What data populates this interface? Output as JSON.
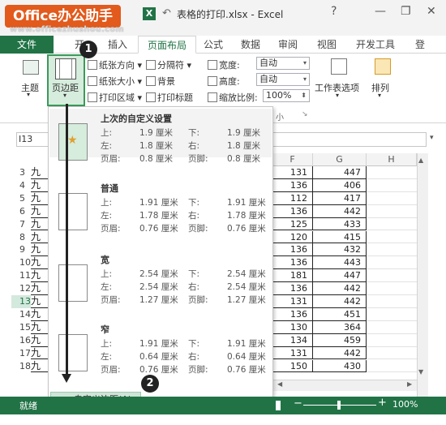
{
  "brand": {
    "name": "Office办公助手",
    "site": "www.officezhushou.com"
  },
  "window": {
    "title": "表格的打印.xlsx - Excel",
    "help": "?",
    "minimize": "—",
    "restore": "❐",
    "close": "✕"
  },
  "tabs": {
    "file": "文件",
    "start": "开",
    "insert": "插入",
    "page_layout": "页面布局",
    "formulas": "公式",
    "data": "数据",
    "review": "审阅",
    "view": "视图",
    "developer": "开发工具",
    "login": "登"
  },
  "ribbon": {
    "themes": "主题",
    "margins": "页边距",
    "orientation": "纸张方向 ▾",
    "size": "纸张大小 ▾",
    "print_area": "打印区域 ▾",
    "breaks": "分隔符 ▾",
    "background": "背景",
    "print_titles": "打印标题",
    "width_label": "宽度:",
    "width_value": "自动",
    "height_label": "高度:",
    "height_value": "自动",
    "scale_label": "缩放比例:",
    "scale_value": "100%",
    "sheet_options": "工作表选项",
    "arrange": "排列",
    "group_label_small": "小"
  },
  "margin_menu": {
    "presets": [
      {
        "title": "上次的自定义设置",
        "rows": [
          [
            "上:",
            "1.9 厘米",
            "下:",
            "1.9 厘米"
          ],
          [
            "左:",
            "1.8 厘米",
            "右:",
            "1.8 厘米"
          ],
          [
            "页眉:",
            "0.8 厘米",
            "页脚:",
            "0.8 厘米"
          ]
        ]
      },
      {
        "title": "普通",
        "rows": [
          [
            "上:",
            "1.91 厘米",
            "下:",
            "1.91 厘米"
          ],
          [
            "左:",
            "1.78 厘米",
            "右:",
            "1.78 厘米"
          ],
          [
            "页眉:",
            "0.76 厘米",
            "页脚:",
            "0.76 厘米"
          ]
        ]
      },
      {
        "title": "宽",
        "rows": [
          [
            "上:",
            "2.54 厘米",
            "下:",
            "2.54 厘米"
          ],
          [
            "左:",
            "2.54 厘米",
            "右:",
            "2.54 厘米"
          ],
          [
            "页眉:",
            "1.27 厘米",
            "页脚:",
            "1.27 厘米"
          ]
        ]
      },
      {
        "title": "窄",
        "rows": [
          [
            "上:",
            "1.91 厘米",
            "下:",
            "1.91 厘米"
          ],
          [
            "左:",
            "0.64 厘米",
            "右:",
            "0.64 厘米"
          ],
          [
            "页眉:",
            "0.76 厘米",
            "页脚:",
            "0.76 厘米"
          ]
        ]
      }
    ],
    "custom": "自定义边距(A)..."
  },
  "formula_bar": {
    "name_box": "I13"
  },
  "columns": [
    "F",
    "G",
    "H"
  ],
  "rows": [
    {
      "n": "3",
      "a": "九",
      "f": "131",
      "g": "447"
    },
    {
      "n": "4",
      "a": "九",
      "f": "136",
      "g": "406"
    },
    {
      "n": "5",
      "a": "九",
      "f": "112",
      "g": "417"
    },
    {
      "n": "6",
      "a": "九",
      "f": "136",
      "g": "442"
    },
    {
      "n": "7",
      "a": "九",
      "f": "125",
      "g": "433"
    },
    {
      "n": "8",
      "a": "九",
      "f": "120",
      "g": "415"
    },
    {
      "n": "9",
      "a": "九",
      "f": "136",
      "g": "432"
    },
    {
      "n": "10",
      "a": "九",
      "f": "136",
      "g": "443"
    },
    {
      "n": "11",
      "a": "九",
      "f": "181",
      "g": "447"
    },
    {
      "n": "12",
      "a": "九",
      "f": "136",
      "g": "442"
    },
    {
      "n": "13",
      "a": "九",
      "f": "131",
      "g": "442"
    },
    {
      "n": "14",
      "a": "九",
      "f": "136",
      "g": "451"
    },
    {
      "n": "15",
      "a": "九",
      "f": "130",
      "g": "364"
    },
    {
      "n": "16",
      "a": "九",
      "f": "134",
      "g": "459"
    },
    {
      "n": "17",
      "a": "九",
      "f": "131",
      "g": "442"
    },
    {
      "n": "18",
      "a": "九",
      "f": "150",
      "g": "430"
    }
  ],
  "status": {
    "ready": "就绪",
    "zoom": "100%",
    "zoom_minus": "−",
    "zoom_plus": "+"
  },
  "callouts": [
    "1",
    "2"
  ],
  "colors": {
    "excel_green": "#217346",
    "brand_orange": "#e25a1c",
    "highlight": "#3a9a5b"
  }
}
